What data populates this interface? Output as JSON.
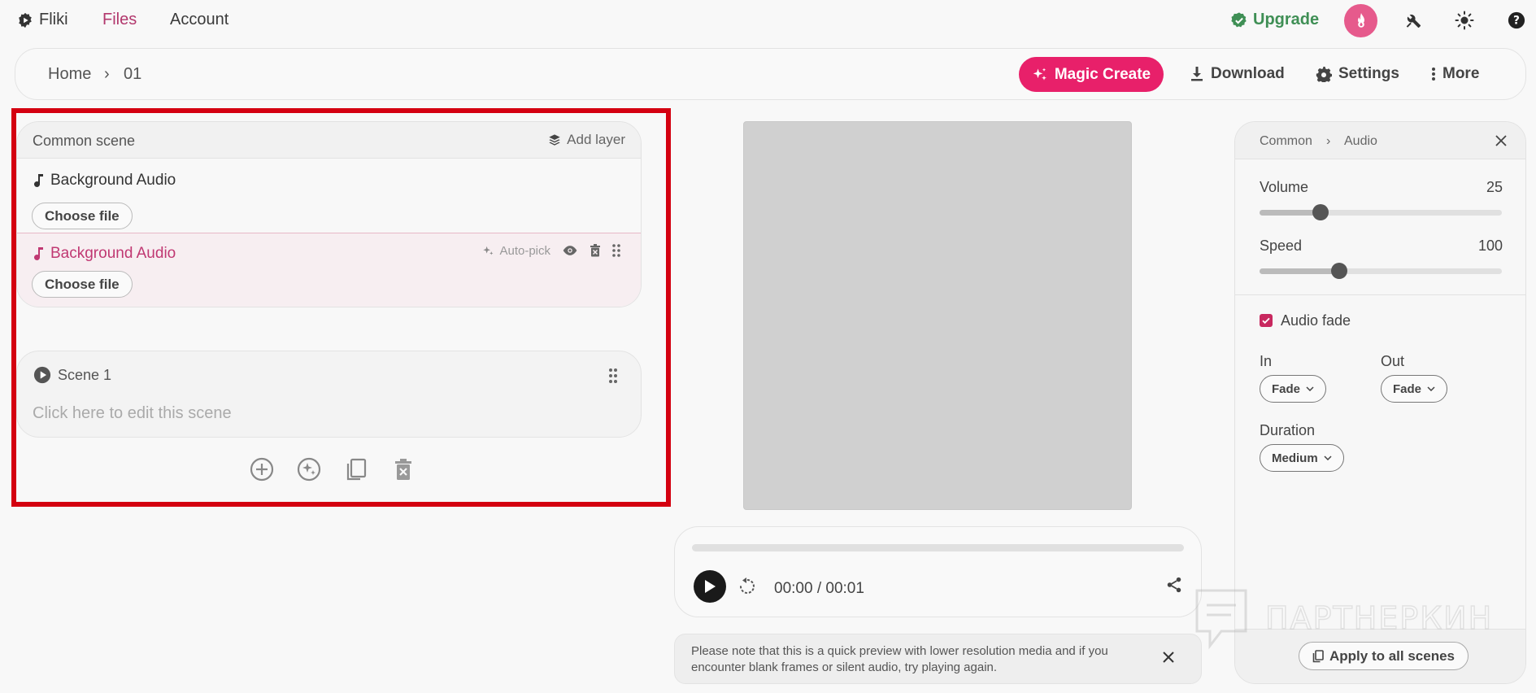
{
  "nav": {
    "logo_label": "Fliki",
    "files": "Files",
    "account": "Account",
    "upgrade": "Upgrade"
  },
  "breadcrumb": {
    "home": "Home",
    "sep": "›",
    "current": "01"
  },
  "toolbar": {
    "magic_create": "Magic Create",
    "download": "Download",
    "settings": "Settings",
    "more": "More"
  },
  "common_scene": {
    "title": "Common scene",
    "add_layer": "Add layer",
    "layers": [
      {
        "label": "Background Audio",
        "button": "Choose file"
      },
      {
        "label": "Background Audio",
        "button": "Choose file",
        "auto_pick": "Auto-pick"
      }
    ]
  },
  "scene": {
    "title": "Scene 1",
    "placeholder": "Click here to edit this scene"
  },
  "player": {
    "time": "00:00 / 00:01",
    "progress": 0
  },
  "notice": {
    "text": "Please note that this is a quick preview with lower resolution media and if you encounter blank frames or silent audio, try playing again."
  },
  "panel": {
    "crumb_parent": "Common",
    "crumb_sep": "›",
    "crumb_current": "Audio",
    "volume_label": "Volume",
    "volume_value": "25",
    "volume_fraction": 0.25,
    "speed_label": "Speed",
    "speed_value": "100",
    "speed_fraction": 0.33,
    "audio_fade_label": "Audio fade",
    "audio_fade_checked": true,
    "in_label": "In",
    "in_value": "Fade",
    "out_label": "Out",
    "out_value": "Fade",
    "duration_label": "Duration",
    "duration_value": "Medium",
    "apply_all": "Apply to all scenes"
  },
  "watermark": {
    "text": "ПАРТНЕРКИН"
  },
  "colors": {
    "accent": "#e8206a",
    "active_nav": "#b2386d",
    "upgrade": "#3f8f55",
    "highlight": "#d40010"
  }
}
